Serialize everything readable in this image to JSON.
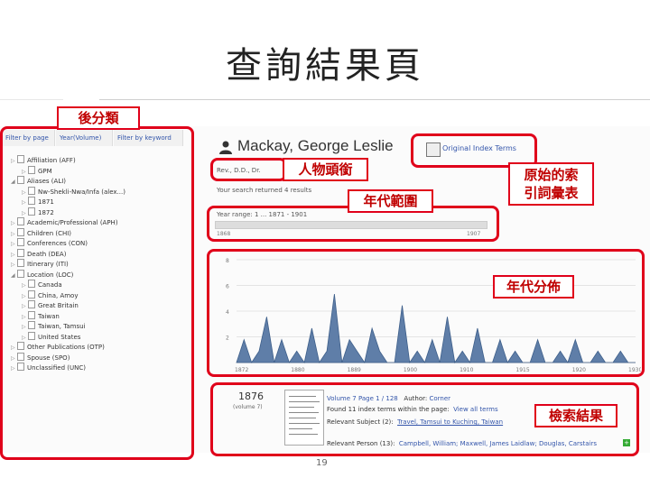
{
  "slide": {
    "title": "查詢結果頁",
    "page_number": "19"
  },
  "annotations": {
    "post_classify": "後分類",
    "person_header": "人物頭銜",
    "original_index": "原始的索\n引詞彙表",
    "year_range": "年代範圍",
    "year_distribution": "年代分佈",
    "search_results": "檢索結果"
  },
  "filter_tabs": [
    "Filter by page",
    "Year(Volume)",
    "Filter by keyword"
  ],
  "tree": [
    {
      "label": "Affiliation (AFF)",
      "expanded": false,
      "indent": 0
    },
    {
      "label": "GPM",
      "expanded": false,
      "indent": 1
    },
    {
      "label": "Aliases (ALI)",
      "expanded": true,
      "indent": 0
    },
    {
      "label": "Nw-Shekli-Nwa/Infa (alex...)",
      "expanded": false,
      "indent": 1
    },
    {
      "label": "1871",
      "expanded": false,
      "indent": 1
    },
    {
      "label": "1872",
      "expanded": false,
      "indent": 1
    },
    {
      "label": "Academic/Professional (APH)",
      "expanded": false,
      "indent": 0
    },
    {
      "label": "Children (CHI)",
      "expanded": false,
      "indent": 0
    },
    {
      "label": "Conferences (CON)",
      "expanded": false,
      "indent": 0
    },
    {
      "label": "Death (DEA)",
      "expanded": false,
      "indent": 0
    },
    {
      "label": "Itinerary (ITI)",
      "expanded": false,
      "indent": 0
    },
    {
      "label": "Location (LOC)",
      "expanded": true,
      "indent": 0
    },
    {
      "label": "Canada",
      "expanded": false,
      "indent": 1
    },
    {
      "label": "China, Amoy",
      "expanded": false,
      "indent": 1
    },
    {
      "label": "Great Britain",
      "expanded": false,
      "indent": 1
    },
    {
      "label": "Taiwan",
      "expanded": false,
      "indent": 1
    },
    {
      "label": "Taiwan, Tamsui",
      "expanded": false,
      "indent": 1
    },
    {
      "label": "United States",
      "expanded": false,
      "indent": 1
    },
    {
      "label": "Other Publications (OTP)",
      "expanded": false,
      "indent": 0
    },
    {
      "label": "Spouse (SPO)",
      "expanded": false,
      "indent": 0
    },
    {
      "label": "Unclassified (UNC)",
      "expanded": false,
      "indent": 0
    }
  ],
  "person": {
    "name": "Mackay, George Leslie",
    "meta": "Rev., D.D., Dr.",
    "original_index_label": "Original Index Terms",
    "result_count": "Your search returned 4 results",
    "year_range": "Year range: 1 ... 1871 - 1901",
    "slider_min": "1868",
    "slider_max": "1907"
  },
  "chart_data": {
    "type": "area",
    "x_ticks": [
      "1872",
      "1880",
      "1889",
      "1900",
      "1910",
      "1915",
      "1920",
      "1930"
    ],
    "y_ticks": [
      "8",
      "6",
      "4",
      "2"
    ],
    "ylim": [
      0,
      9
    ],
    "values": [
      0,
      2,
      0,
      1,
      4,
      0,
      2,
      0,
      1,
      0,
      3,
      0,
      1,
      6,
      0,
      2,
      1,
      0,
      3,
      1,
      0,
      0,
      5,
      0,
      1,
      0,
      2,
      0,
      4,
      0,
      1,
      0,
      3,
      0,
      0,
      2,
      0,
      1,
      0,
      0,
      2,
      0,
      0,
      1,
      0,
      2,
      0,
      0,
      1,
      0,
      0,
      1,
      0,
      0
    ]
  },
  "result": {
    "year": "1876",
    "volume": "(volume 7)",
    "line1_vol": "Volume 7 Page 1 / 128",
    "line1_author_label": "Author:",
    "line1_author": "Corner",
    "line2": "Found 11 index terms within the page:",
    "line2_link": "View all terms",
    "line3_label": "Relevant Subject (2):",
    "line3_value": "Travel, Tamsui to Kuching, Taiwan",
    "line4_label": "Relevant Person (13):",
    "line4_value": "Campbell, William; Maxwell, James Laidlaw; Douglas, Carstairs",
    "add": "+"
  }
}
